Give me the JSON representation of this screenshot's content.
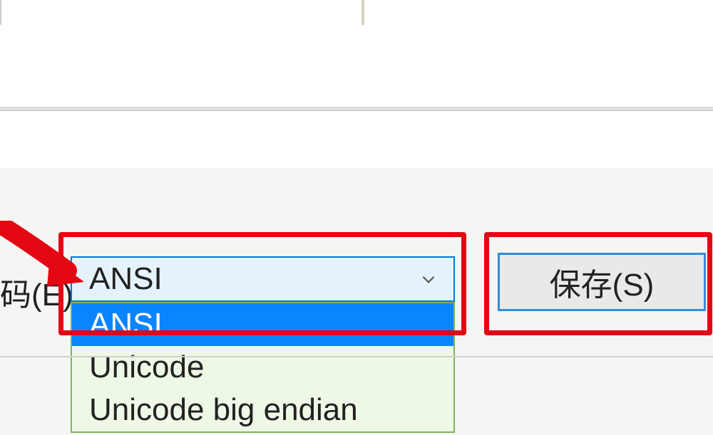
{
  "encoding": {
    "label_fragment": "码(E):",
    "selected": "ANSI",
    "options": [
      "ANSI",
      "Unicode",
      "Unicode big endian"
    ]
  },
  "buttons": {
    "save_label": "保存(S)"
  }
}
